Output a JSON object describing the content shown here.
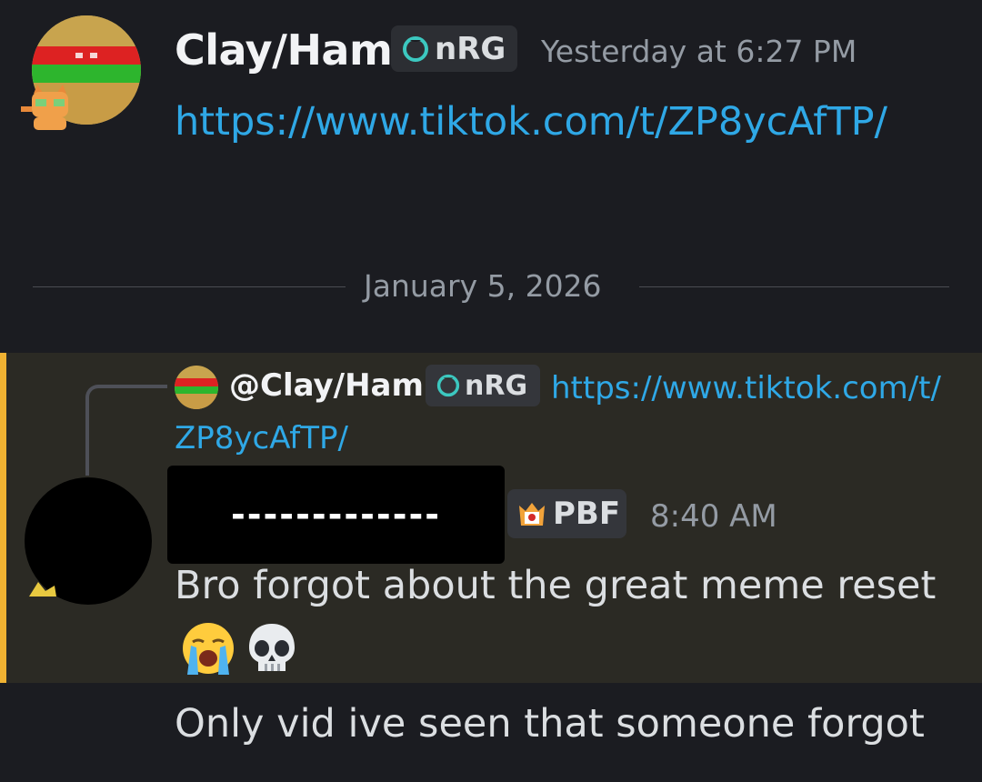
{
  "message1": {
    "author": "Clay/Ham",
    "tag": "nRG",
    "timestamp": "Yesterday at 6:27 PM",
    "link": "https://www.tiktok.com/t/ZP8ycAfTP/"
  },
  "divider": {
    "date": "January 5, 2026"
  },
  "reply": {
    "author": "@Clay/Ham",
    "tag": "nRG",
    "link": "https://www.tiktok.com/t/ZP8ycAfTP/"
  },
  "message2": {
    "author_redacted": "-------------",
    "tag": "PBF",
    "timestamp": "8:40 AM",
    "text": "Bro forgot about the great meme reset",
    "emojis": [
      "loudly-crying-face",
      "skull"
    ]
  },
  "message3": {
    "text": "Only vid ive seen that someone forgot"
  },
  "colors": {
    "link": "#2fa8e6",
    "mention_bar": "#f0b232",
    "mention_bg": "#2b2a24",
    "background": "#1b1c21"
  }
}
